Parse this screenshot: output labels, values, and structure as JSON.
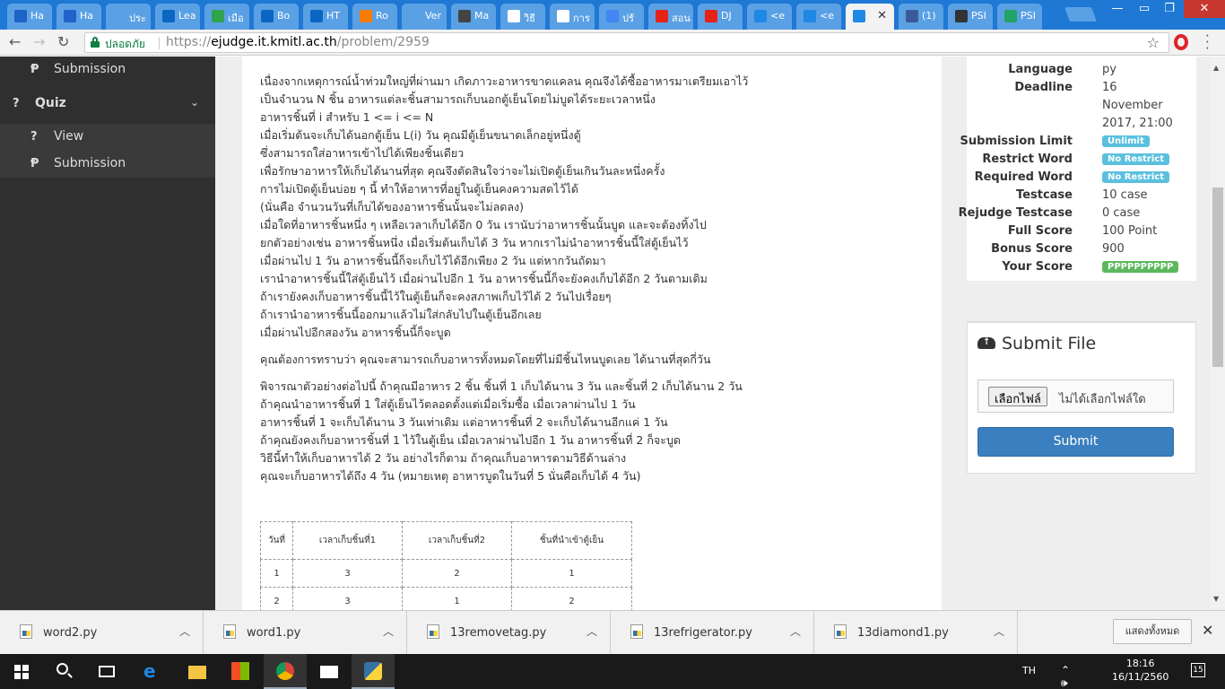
{
  "browser": {
    "tabs": [
      {
        "label": "Ha",
        "icon": "hackerrank-icon",
        "color": "#1e63c8"
      },
      {
        "label": "Ha",
        "icon": "hackerrank-icon",
        "color": "#1e63c8"
      },
      {
        "label": "ประ",
        "icon": "history-icon",
        "color": "#5aa0e4"
      },
      {
        "label": "Lea",
        "icon": "linkedin-icon",
        "color": "#0a66c2"
      },
      {
        "label": "เมือ",
        "icon": "site-icon",
        "color": "#2ea44f"
      },
      {
        "label": "Bo",
        "icon": "linkedin-icon",
        "color": "#0a66c2"
      },
      {
        "label": "HT",
        "icon": "linkedin-icon",
        "color": "#0a66c2"
      },
      {
        "label": "Ro",
        "icon": "running-icon",
        "color": "#f57c00"
      },
      {
        "label": "Ver",
        "icon": "document-icon",
        "color": "#5aa0e4"
      },
      {
        "label": "Ma",
        "icon": "calculator-icon",
        "color": "#444444"
      },
      {
        "label": "วิธี",
        "icon": "google-icon",
        "color": "#ffffff"
      },
      {
        "label": "การ",
        "icon": "google-icon",
        "color": "#ffffff"
      },
      {
        "label": "ปรั",
        "icon": "docs-icon",
        "color": "#4285f4"
      },
      {
        "label": "สอน",
        "icon": "youtube-icon",
        "color": "#e62117"
      },
      {
        "label": "DJ",
        "icon": "youtube-icon",
        "color": "#e62117"
      },
      {
        "label": "<e",
        "icon": "ejudge-icon",
        "color": "#1e88e5"
      },
      {
        "label": "<e",
        "icon": "ejudge-icon",
        "color": "#1e88e5"
      },
      {
        "label": "",
        "icon": "ejudge-icon",
        "color": "#1e88e5",
        "active": true
      },
      {
        "label": "(1)",
        "icon": "facebook-icon",
        "color": "#3b5998"
      },
      {
        "label": "PSI",
        "icon": "github-icon",
        "color": "#333333"
      },
      {
        "label": "PSI",
        "icon": "drive-icon",
        "color": "#1fa463"
      }
    ],
    "secure_label": "ปลอดภัย",
    "url_prefix": "https://",
    "url_main": "ejudge.it.kmitl.ac.th",
    "url_path": "/problem/2959"
  },
  "sidebar": {
    "submission_top": "Submission",
    "quiz": "Quiz",
    "view": "View",
    "submission_bottom": "Submission"
  },
  "problem": {
    "lines1": [
      "เนื่องจากเหตุการณ์น้ำท่วมใหญ่ที่ผ่านมา เกิดภาวะอาหารขาดแคลน คุณจึงได้ซื้ออาหารมาเตรียมเอาไว้",
      "เป็นจำนวน N ชิ้น อาหารแต่ละชิ้นสามารถเก็บนอกตู้เย็นโดยไม่บูดได้ระยะเวลาหนึ่ง",
      "อาหารชิ้นที่ i สำหรับ 1 <= i <= N",
      "เมื่อเริ่มต้นจะเก็บได้นอกตู้เย็น L(i) วัน คุณมีตู้เย็นขนาดเล็กอยู่หนึ่งตู้",
      "ซึ่งสามารถใส่อาหารเข้าไปได้เพียงชิ้นเดียว",
      "เพื่อรักษาอาหารให้เก็บได้นานที่สุด คุณจึงตัดสินใจว่าจะไม่เปิดตู้เย็นเกินวันละหนึ่งครั้ง",
      "การไม่เปิดตู้เย็นบ่อย ๆ นี้ ทำให้อาหารที่อยู่ในตู้เย็นคงความสดไว้ได้",
      "(นั่นคือ จำนวนวันที่เก็บได้ของอาหารชิ้นนั้นจะไม่ลดลง)",
      "เมื่อใดที่อาหารชิ้นหนึ่ง ๆ เหลือเวลาเก็บได้อีก 0 วัน เรานับว่าอาหารชิ้นนั้นบูด และจะต้องทิ้งไป",
      "ยกตัวอย่างเช่น อาหารชิ้นหนึ่ง เมื่อเริ่มต้นเก็บได้ 3 วัน หากเราไม่นำอาหารชิ้นนี้ใส่ตู้เย็นไว้",
      "เมื่อผ่านไป 1 วัน อาหารชิ้นนี้ก็จะเก็บไว้ได้อีกเพียง 2 วัน แต่หากวันถัดมา",
      "เรานำอาหารชิ้นนี้ใส่ตู้เย็นไว้ เมื่อผ่านไปอีก 1 วัน อาหารชิ้นนี้ก็จะยังคงเก็บได้อีก 2 วันตามเดิม",
      "ถ้าเรายังคงเก็บอาหารชิ้นนี้ไว้ในตู้เย็นก็จะคงสภาพเก็บไว้ได้ 2 วันไปเรื่อยๆ",
      "ถ้าเรานำอาหารชิ้นนี้ออกมาแล้วไม่ใส่กลับไปในตู้เย็นอีกเลย",
      "เมื่อผ่านไปอีกสองวัน อาหารชิ้นนี้ก็จะบูด"
    ],
    "question": "คุณต้องการทราบว่า คุณจะสามารถเก็บอาหารทั้งหมดโดยที่ไม่มีชิ้นไหนบูดเลย ได้นานที่สุดกี่วัน",
    "lines2": [
      "พิจารณาตัวอย่างต่อไปนี้ ถ้าคุณมีอาหาร 2 ชิ้น ชิ้นที่ 1 เก็บได้นาน 3 วัน และชิ้นที่ 2 เก็บได้นาน 2 วัน",
      "ถ้าคุณนำอาหารชิ้นที่ 1 ใส่ตู้เย็นไว้ตลอดตั้งแต่เมื่อเริ่มซื้อ เมื่อเวลาผ่านไป 1 วัน",
      "อาหารชิ้นที่ 1 จะเก็บได้นาน 3 วันเท่าเดิม แต่อาหารชิ้นที่ 2 จะเก็บได้นานอีกแค่ 1 วัน",
      "ถ้าคุณยังคงเก็บอาหารชิ้นที่ 1 ไว้ในตู้เย็น เมื่อเวลาผ่านไปอีก 1 วัน อาหารชิ้นที่ 2 ก็จะบูด",
      "วิธีนี้ทำให้เก็บอาหารได้ 2 วัน อย่างไรก็ตาม ถ้าคุณเก็บอาหารตามวิธีด้านล่าง",
      "คุณจะเก็บอาหารได้ถึง 4 วัน (หมายเหตุ อาหารบูดในวันที่ 5 นั่นคือเก็บได้ 4 วัน)"
    ],
    "table": {
      "headers": [
        "วันที่",
        "เวลาเก็บชิ้นที่1",
        "เวลาเก็บชิ้นที่2",
        "ชิ้นที่นำเข้าตู้เย็น"
      ],
      "rows": [
        [
          "1",
          "3",
          "2",
          "1"
        ],
        [
          "2",
          "3",
          "1",
          "2"
        ]
      ]
    }
  },
  "info": {
    "language_k": "Language",
    "language_v": "py",
    "deadline_k": "Deadline",
    "deadline_v1": "16",
    "deadline_v2": "November",
    "deadline_v3": "2017, 21:00",
    "sublimit_k": "Submission Limit",
    "sublimit_v": "Unlimit",
    "restrict_k": "Restrict Word",
    "restrict_v": "No Restrict",
    "required_k": "Required Word",
    "required_v": "No Restrict",
    "testcase_k": "Testcase",
    "testcase_v": "10 case",
    "rejudge_k": "Rejudge Testcase",
    "rejudge_v": "0 case",
    "full_k": "Full Score",
    "full_v": "100 Point",
    "bonus_k": "Bonus Score",
    "bonus_v": "900",
    "your_k": "Your Score",
    "your_v": "PPPPPPPPPP",
    "colors": {
      "info": "#5bc0de",
      "success": "#5cb85c"
    }
  },
  "upload": {
    "title": "Submit File",
    "choose": "เลือกไฟล์",
    "nofile": "ไม่ได้เลือกไฟล์ใด",
    "submit": "Submit"
  },
  "downloads": {
    "files": [
      "word2.py",
      "word1.py",
      "13removetag.py",
      "13refrigerator.py",
      "13diamond1.py"
    ],
    "show_all": "แสดงทั้งหมด"
  },
  "taskbar": {
    "lang": "TH",
    "time": "18:16",
    "date": "16/11/2560",
    "notifications": "15"
  }
}
